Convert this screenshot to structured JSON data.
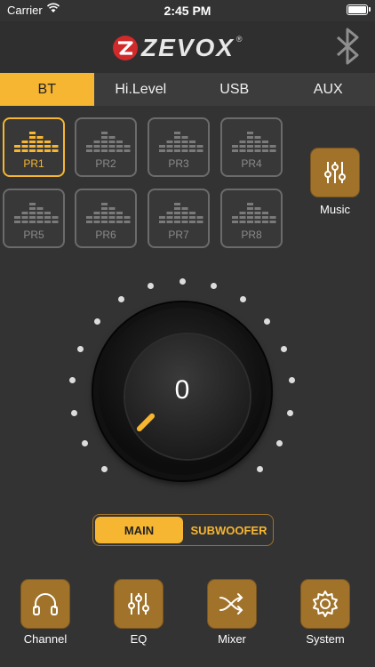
{
  "status_bar": {
    "carrier": "Carrier",
    "time": "2:45 PM"
  },
  "header": {
    "brand": "ZEVOX",
    "registered": "®",
    "icon": "bluetooth-icon"
  },
  "tabs": [
    {
      "label": "BT",
      "active": true
    },
    {
      "label": "Hi.Level",
      "active": false
    },
    {
      "label": "USB",
      "active": false
    },
    {
      "label": "AUX",
      "active": false
    }
  ],
  "presets": [
    {
      "label": "PR1",
      "active": true
    },
    {
      "label": "PR2",
      "active": false
    },
    {
      "label": "PR3",
      "active": false
    },
    {
      "label": "PR4",
      "active": false
    },
    {
      "label": "PR5",
      "active": false
    },
    {
      "label": "PR6",
      "active": false
    },
    {
      "label": "PR7",
      "active": false
    },
    {
      "label": "PR8",
      "active": false
    }
  ],
  "music_button": {
    "label": "Music",
    "icon": "sliders-icon"
  },
  "volume_knob": {
    "value": "0"
  },
  "output_selector": {
    "options": [
      "MAIN",
      "SUBWOOFER"
    ],
    "selected": "MAIN"
  },
  "bottom_nav": [
    {
      "label": "Channel",
      "icon": "headphones-icon"
    },
    {
      "label": "EQ",
      "icon": "sliders-icon"
    },
    {
      "label": "Mixer",
      "icon": "shuffle-icon"
    },
    {
      "label": "System",
      "icon": "gear-icon"
    }
  ],
  "colors": {
    "accent": "#f6b631",
    "button_bronze": "#a1732a",
    "background": "#333333"
  }
}
